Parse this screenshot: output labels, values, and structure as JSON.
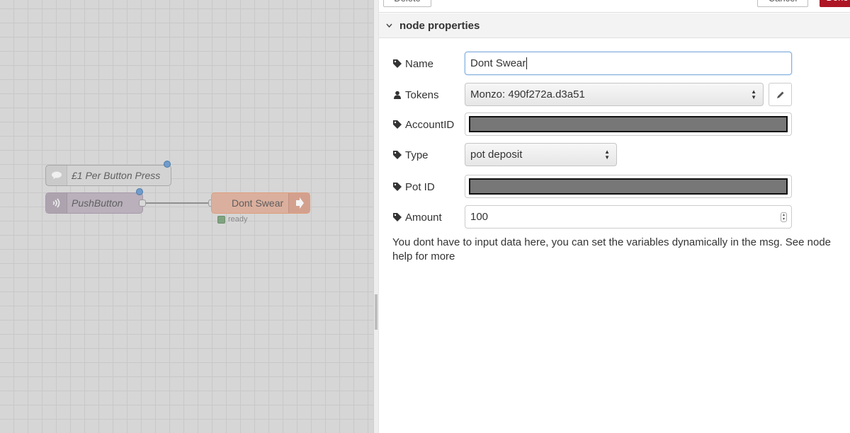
{
  "workspace": {
    "nodes": {
      "comment": {
        "label": "£1 Per Button Press"
      },
      "pushbutton": {
        "label": "PushButton"
      },
      "monzo": {
        "label": "Dont Swear",
        "status": "ready"
      }
    }
  },
  "toolbar": {
    "delete_label": "Delete",
    "cancel_label": "Cancel",
    "done_label": "Done"
  },
  "section": {
    "title": "node properties"
  },
  "form": {
    "name": {
      "label": "Name",
      "value": "Dont Swear"
    },
    "tokens": {
      "label": "Tokens",
      "value": "Monzo: 490f272a.d3a51"
    },
    "account_id": {
      "label": "AccountID"
    },
    "type": {
      "label": "Type",
      "value": "pot deposit"
    },
    "pot_id": {
      "label": "Pot ID"
    },
    "amount": {
      "label": "Amount",
      "value": "100"
    }
  },
  "help_text": "You dont have to input data here, you can set the variables dynamically in the msg. See node help for more",
  "colors": {
    "accent": "#ad1625",
    "focus": "#85b0e0",
    "monzo_node": "#dbaf9e",
    "push_node": "#b9b0bb"
  },
  "icons": {
    "field_label": "tag-icon",
    "tokens_label": "user-icon",
    "edit": "pencil-icon",
    "section": "chevron-down-icon"
  }
}
